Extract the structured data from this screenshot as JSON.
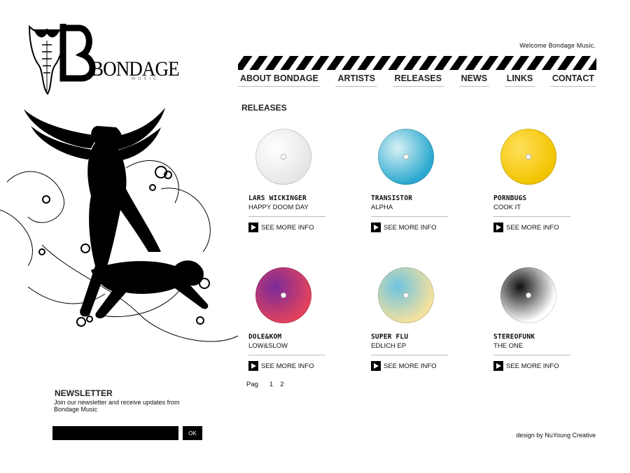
{
  "header": {
    "logo_text": "BONDAGE",
    "logo_sub": "MUSIC",
    "welcome": "Welcome Bondage Music."
  },
  "nav": {
    "items": [
      {
        "label": "ABOUT BONDAGE"
      },
      {
        "label": "ARTISTS"
      },
      {
        "label": "RELEASES"
      },
      {
        "label": "NEWS"
      },
      {
        "label": "LINKS"
      },
      {
        "label": "CONTACT"
      }
    ]
  },
  "main": {
    "section_title": "RELEASES",
    "more_label": "SEE MORE INFO",
    "releases": [
      {
        "artist": "LARS WICKINGER",
        "title": "HAPPY DOOM DAY",
        "disc_color": "#e6e6e6",
        "disc_color2": "#ffffff"
      },
      {
        "artist": "TRANSISTOR",
        "title": "ALPHA",
        "disc_color": "#2aa9cf",
        "disc_color2": "#d9f0f5"
      },
      {
        "artist": "PORNBUGS",
        "title": "COOK IT",
        "disc_color": "#f2c400",
        "disc_color2": "#ffe05a"
      },
      {
        "artist": "DOLE&KOM",
        "title": "LOW&SLOW",
        "disc_color": "#e0425e",
        "disc_color2": "#7a2a9a"
      },
      {
        "artist": "SUPER FLU",
        "title": "EDLICH EP",
        "disc_color": "#f3e1a0",
        "disc_color2": "#6cc3e0"
      },
      {
        "artist": "STEREOFUNK",
        "title": "THE ONE",
        "disc_color": "#ffffff",
        "disc_color2": "#111111"
      }
    ],
    "pagination": {
      "label": "Pag",
      "pages": [
        "1",
        "2"
      ]
    }
  },
  "newsletter": {
    "title": "NEWSLETTER",
    "description": "Join our newsletter and receive updates from Bondage Music",
    "input_value": "",
    "button_label": "OK"
  },
  "footer": {
    "credit": "design by NuYoung Creative"
  }
}
